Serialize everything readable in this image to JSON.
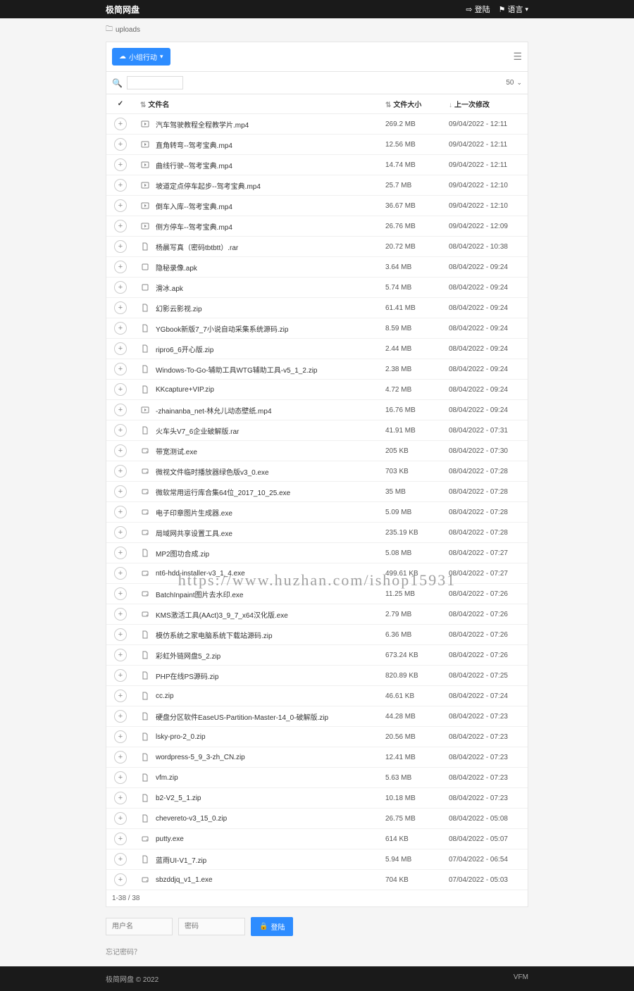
{
  "header": {
    "title": "极简网盘",
    "login": "登陆",
    "lang": "语言"
  },
  "breadcrumb": "uploads",
  "toolbar": {
    "action_btn": "小组行动"
  },
  "search": {
    "placeholder": "",
    "per_page": "50"
  },
  "columns": {
    "name": "文件名",
    "size": "文件大小",
    "date": "上一次修改"
  },
  "files": [
    {
      "icon": "video",
      "name": "汽车驾驶教程全程教学片.mp4",
      "size": "269.2 MB",
      "date": "09/04/2022 - 12:11"
    },
    {
      "icon": "video",
      "name": "直角转弯--驾考宝典.mp4",
      "size": "12.56 MB",
      "date": "09/04/2022 - 12:11"
    },
    {
      "icon": "video",
      "name": "曲线行驶--驾考宝典.mp4",
      "size": "14.74 MB",
      "date": "09/04/2022 - 12:11"
    },
    {
      "icon": "video",
      "name": "坡道定点停车起步--驾考宝典.mp4",
      "size": "25.7 MB",
      "date": "09/04/2022 - 12:10"
    },
    {
      "icon": "video",
      "name": "倒车入库--驾考宝典.mp4",
      "size": "36.67 MB",
      "date": "09/04/2022 - 12:10"
    },
    {
      "icon": "video",
      "name": "侧方停车--驾考宝典.mp4",
      "size": "26.76 MB",
      "date": "09/04/2022 - 12:09"
    },
    {
      "icon": "file",
      "name": "杨晨写真（密码tbtbtt）.rar",
      "size": "20.72 MB",
      "date": "08/04/2022 - 10:38"
    },
    {
      "icon": "box",
      "name": "隐秘录像.apk",
      "size": "3.64 MB",
      "date": "08/04/2022 - 09:24"
    },
    {
      "icon": "box",
      "name": "滑冰.apk",
      "size": "5.74 MB",
      "date": "08/04/2022 - 09:24"
    },
    {
      "icon": "file",
      "name": "幻影云影视.zip",
      "size": "61.41 MB",
      "date": "08/04/2022 - 09:24"
    },
    {
      "icon": "file",
      "name": "YGbook新版7_7小说自动采集系统源码.zip",
      "size": "8.59 MB",
      "date": "08/04/2022 - 09:24"
    },
    {
      "icon": "file",
      "name": "ripro6_6开心版.zip",
      "size": "2.44 MB",
      "date": "08/04/2022 - 09:24"
    },
    {
      "icon": "file",
      "name": "Windows-To-Go-辅助工具WTG辅助工具-v5_1_2.zip",
      "size": "2.38 MB",
      "date": "08/04/2022 - 09:24"
    },
    {
      "icon": "file",
      "name": "KKcapture+VIP.zip",
      "size": "4.72 MB",
      "date": "08/04/2022 - 09:24"
    },
    {
      "icon": "video",
      "name": "-zhainanba_net-林允儿动态壁纸.mp4",
      "size": "16.76 MB",
      "date": "08/04/2022 - 09:24"
    },
    {
      "icon": "file",
      "name": "火车头V7_6企业破解版.rar",
      "size": "41.91 MB",
      "date": "08/04/2022 - 07:31"
    },
    {
      "icon": "disk",
      "name": "带宽测试.exe",
      "size": "205 KB",
      "date": "08/04/2022 - 07:30"
    },
    {
      "icon": "disk",
      "name": "微视文件临时播放器绿色版v3_0.exe",
      "size": "703 KB",
      "date": "08/04/2022 - 07:28"
    },
    {
      "icon": "disk",
      "name": "微软常用运行库合集64位_2017_10_25.exe",
      "size": "35 MB",
      "date": "08/04/2022 - 07:28"
    },
    {
      "icon": "disk",
      "name": "电子印章图片生成器.exe",
      "size": "5.09 MB",
      "date": "08/04/2022 - 07:28"
    },
    {
      "icon": "disk",
      "name": "局域网共享设置工具.exe",
      "size": "235.19 KB",
      "date": "08/04/2022 - 07:28"
    },
    {
      "icon": "file",
      "name": "MP2图功合成.zip",
      "size": "5.08 MB",
      "date": "08/04/2022 - 07:27"
    },
    {
      "icon": "disk",
      "name": "nt6-hdd-installer-v3_1_4.exe",
      "size": "499.61 KB",
      "date": "08/04/2022 - 07:27"
    },
    {
      "icon": "disk",
      "name": "BatchInpaint图片去水印.exe",
      "size": "11.25 MB",
      "date": "08/04/2022 - 07:26"
    },
    {
      "icon": "disk",
      "name": "KMS激活工具(AAct)3_9_7_x64汉化版.exe",
      "size": "2.79 MB",
      "date": "08/04/2022 - 07:26"
    },
    {
      "icon": "file",
      "name": "模仿系统之家电脑系统下载站源码.zip",
      "size": "6.36 MB",
      "date": "08/04/2022 - 07:26"
    },
    {
      "icon": "file",
      "name": "彩虹外链网盘5_2.zip",
      "size": "673.24 KB",
      "date": "08/04/2022 - 07:26"
    },
    {
      "icon": "file",
      "name": "PHP在线PS源码.zip",
      "size": "820.89 KB",
      "date": "08/04/2022 - 07:25"
    },
    {
      "icon": "file",
      "name": "cc.zip",
      "size": "46.61 KB",
      "date": "08/04/2022 - 07:24"
    },
    {
      "icon": "file",
      "name": "硬盘分区软件EaseUS-Partition-Master-14_0-破解版.zip",
      "size": "44.28 MB",
      "date": "08/04/2022 - 07:23"
    },
    {
      "icon": "file",
      "name": "lsky-pro-2_0.zip",
      "size": "20.56 MB",
      "date": "08/04/2022 - 07:23"
    },
    {
      "icon": "file",
      "name": "wordpress-5_9_3-zh_CN.zip",
      "size": "12.41 MB",
      "date": "08/04/2022 - 07:23"
    },
    {
      "icon": "file",
      "name": "vfm.zip",
      "size": "5.63 MB",
      "date": "08/04/2022 - 07:23"
    },
    {
      "icon": "file",
      "name": "b2-V2_5_1.zip",
      "size": "10.18 MB",
      "date": "08/04/2022 - 07:23"
    },
    {
      "icon": "file",
      "name": "chevereto-v3_15_0.zip",
      "size": "26.75 MB",
      "date": "08/04/2022 - 05:08"
    },
    {
      "icon": "disk",
      "name": "putty.exe",
      "size": "614 KB",
      "date": "08/04/2022 - 05:07"
    },
    {
      "icon": "file",
      "name": "蓝雨UI-V1_7.zip",
      "size": "5.94 MB",
      "date": "07/04/2022 - 06:54"
    },
    {
      "icon": "disk",
      "name": "sbzddjq_v1_1.exe",
      "size": "704 KB",
      "date": "07/04/2022 - 05:03"
    }
  ],
  "pager": "1-38 / 38",
  "login": {
    "user_ph": "用户名",
    "pass_ph": "密码",
    "btn": "登陆",
    "forgot": "忘记密码？"
  },
  "footer": {
    "left": "极简网盘 © 2022",
    "right": "VFM"
  },
  "watermark": "https://www.huzhan.com/ishop15931"
}
